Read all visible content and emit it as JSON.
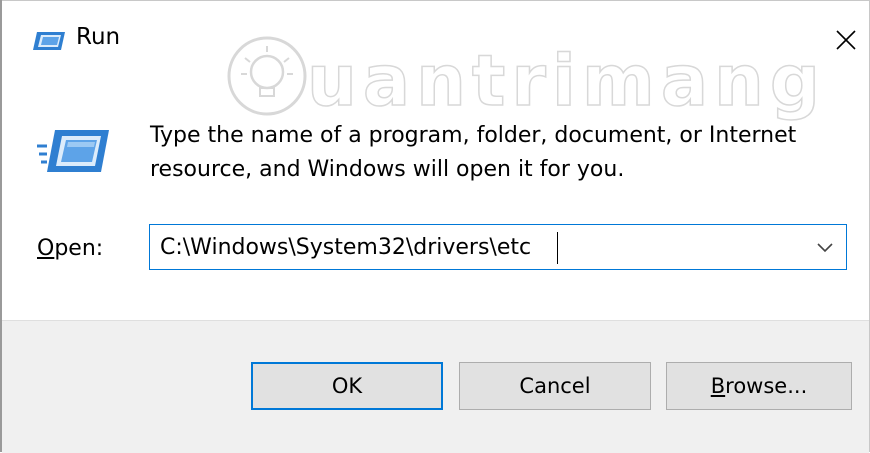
{
  "window": {
    "title": "Run",
    "title_icon": "run-icon",
    "close_icon": "close-icon"
  },
  "watermark": {
    "text": "uantrimang",
    "icon": "lightbulb-icon"
  },
  "body": {
    "program_icon": "run-icon",
    "description_line1": "Type the name of a program, folder, document, or Internet",
    "description_line2": "resource, and Windows will open it for you."
  },
  "open": {
    "label_mnemonic": "O",
    "label_rest": "pen:",
    "value": "C:\\Windows\\System32\\drivers\\etc",
    "dropdown_icon": "chevron-down-icon"
  },
  "buttons": {
    "ok": "OK",
    "cancel": "Cancel",
    "browse_mnemonic": "B",
    "browse_rest": "rowse..."
  },
  "colors": {
    "accent": "#0078d7",
    "footer_bg": "#f0f0f0",
    "button_bg": "#e1e1e1"
  }
}
